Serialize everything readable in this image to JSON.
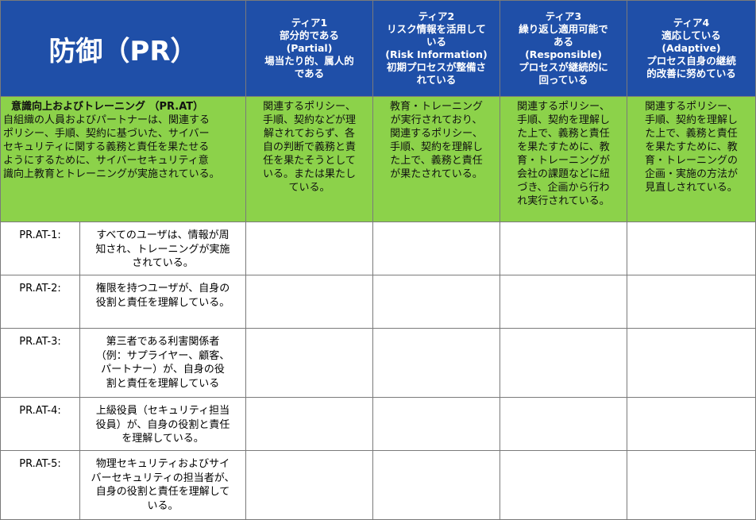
{
  "title": "防御（PR）",
  "tiers": [
    {
      "lines": [
        "ティア1",
        "部分的である",
        "(Partial)",
        "場当たり的、属人的",
        "である"
      ]
    },
    {
      "lines": [
        "ティア2",
        "リスク情報を活用して",
        "いる",
        "(Risk Information)",
        "初期プロセスが整備さ",
        "れている"
      ]
    },
    {
      "lines": [
        "ティア3",
        "繰り返し適用可能で",
        "ある",
        "(Responsible)",
        "プロセスが継続的に",
        "回っている"
      ]
    },
    {
      "lines": [
        "ティア4",
        "適応している",
        "(Adaptive)",
        "プロセス自身の継続",
        "的改善に努めている"
      ]
    }
  ],
  "category": {
    "title": "意識向上およびトレーニング （PR.AT）",
    "lines": [
      "自組織の人員およびパートナーは、関連する",
      "ポリシー、手順、契約に基づいた、サイバー",
      "セキュリティに関する義務と責任を果たせる",
      "ようにするために、サイバーセキュリティ意",
      "識向上教育とトレーニングが実施されている。"
    ]
  },
  "tier_descriptions": [
    {
      "lines": [
        "関連するポリシー、",
        "手順、契約などが理",
        "解されておらず、各",
        "自の判断で義務と責",
        "任を果たそうとして",
        "いる。または果たし",
        "ている。"
      ]
    },
    {
      "lines": [
        "教育・トレーニング",
        "が実行されており、",
        "関連するポリシー、",
        "手順、契約を理解し",
        "た上で、義務と責任",
        "が果たされている。"
      ]
    },
    {
      "lines": [
        "関連するポリシー、",
        "手順、契約を理解し",
        "た上で、義務と責任",
        "を果たすために、教",
        "育・トレーニングが",
        "会社の課題などに紐",
        "づき、企画から行わ",
        "れ実行されている。"
      ]
    },
    {
      "lines": [
        "関連するポリシー、",
        "手順、契約を理解し",
        "た上で、義務と責任",
        "を果たすために、教",
        "育・トレーニングの",
        "企画・実施の方法が",
        "見直しされている。"
      ]
    }
  ],
  "subcategories": [
    {
      "id": "PR.AT-1:",
      "lines": [
        "すべてのユーザは、情報が周",
        "知され、トレーニングが実施",
        "されている。"
      ]
    },
    {
      "id": "PR.AT-2:",
      "lines": [
        "権限を持つユーザが、自身の",
        "役割と責任を理解している。"
      ]
    },
    {
      "id": "PR.AT-3:",
      "lines": [
        "第三者である利害関係者",
        "（例：サプライヤー、顧客、",
        "パートナー）が、自身の役",
        "割と責任を理解している"
      ]
    },
    {
      "id": "PR.AT-4:",
      "lines": [
        "上級役員（セキュリティ担当",
        "役員）が、自身の役割と責任",
        "を理解している。"
      ]
    },
    {
      "id": "PR.AT-5:",
      "lines": [
        "物理セキュリティおよびサイ",
        "バーセキュリティの担当者が、",
        "自身の役割と責任を理解して",
        "いる。"
      ]
    }
  ],
  "colors": {
    "header_blue": "#1f4fa8",
    "category_green": "#8cd24a",
    "grid_line": "#7a7a7a"
  }
}
